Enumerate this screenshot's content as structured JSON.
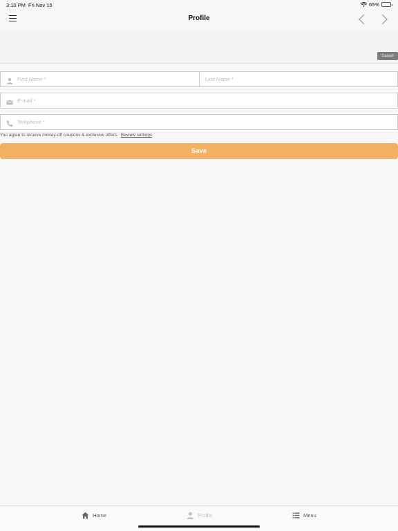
{
  "status_bar": {
    "time": "3:10 PM",
    "date": "Fri Nov 15",
    "battery": "65%",
    "battery_level": 0.65
  },
  "nav": {
    "title": "Profile"
  },
  "header": {
    "cancel_label": "Cancel"
  },
  "form": {
    "first_name": {
      "placeholder": "First Name *",
      "value": ""
    },
    "last_name": {
      "placeholder": "Last Name *",
      "value": ""
    },
    "email": {
      "placeholder": "E-mail *",
      "value": ""
    },
    "telephone": {
      "placeholder": "Telephone *",
      "value": ""
    },
    "consent_text": "You agree to receive money-off coupons & exclusive offers.",
    "review_link": "Review settings",
    "save_label": "Save"
  },
  "tabs": [
    {
      "label": "Home",
      "icon": "home-icon"
    },
    {
      "label": "Profile",
      "icon": "person-icon"
    },
    {
      "label": "Menu",
      "icon": "list-icon"
    }
  ],
  "colors": {
    "accent": "#f2b262",
    "cancel_bg": "#7d7d7d",
    "background": "#f7f7f7"
  }
}
